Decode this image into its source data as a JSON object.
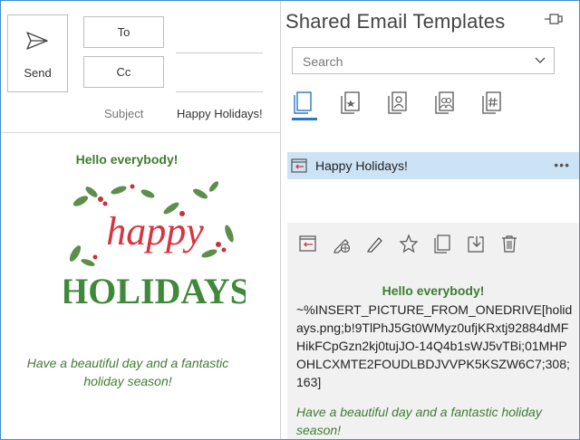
{
  "compose": {
    "send_label": "Send",
    "to_label": "To",
    "cc_label": "Cc",
    "subject_label": "Subject",
    "subject_value": "Happy Holidays!",
    "body": {
      "greeting": "Hello everybody!",
      "image_word1": "happy",
      "image_word2": "HOLIDAYS",
      "closing": "Have a beautiful day and a fantastic holiday season!"
    }
  },
  "pane": {
    "title": "Shared Email Templates",
    "pin_icon": "pin-icon",
    "search_placeholder": "Search",
    "tabs": [
      {
        "icon": "all-templates-icon",
        "active": true
      },
      {
        "icon": "favorites-icon",
        "active": false
      },
      {
        "icon": "my-templates-icon",
        "active": false
      },
      {
        "icon": "shared-templates-icon",
        "active": false
      },
      {
        "icon": "hashtag-templates-icon",
        "active": false
      }
    ],
    "templates": [
      {
        "label": "Happy Holidays!",
        "more": "•••"
      }
    ],
    "preview": {
      "toolbar": [
        "insert-icon",
        "edit-online-icon",
        "edit-icon",
        "favorite-icon",
        "copy-icon",
        "move-icon",
        "delete-icon"
      ],
      "greeting": "Hello everybody!",
      "macro": "~%INSERT_PICTURE_FROM_ONEDRIVE[holidays.png;b!9TlPhJ5Gt0WMyz0ufjKRxtj92884dMFHikFCpGzn2kj0tujJO-14Q4b1sWJ5vTBi;01MHPOHLCXMTE2FOUDLBDJVVPK5KSZW6C7;308;163]",
      "closing": "Have a beautiful day and a fantastic holiday season!"
    }
  },
  "colors": {
    "accent": "#2b78c6",
    "selected_bg": "#cce3f5",
    "green_text": "#3f7c31",
    "preview_bg": "#f1f1f1"
  }
}
